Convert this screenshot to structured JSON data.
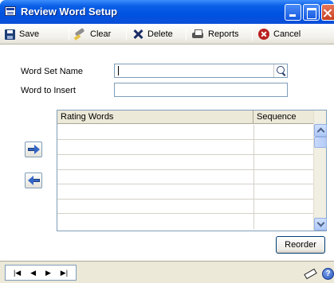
{
  "window": {
    "title": "Review Word Setup"
  },
  "toolbar": {
    "save_label": "Save",
    "clear_label": "Clear",
    "delete_label": "Delete",
    "reports_label": "Reports",
    "cancel_label": "Cancel"
  },
  "form": {
    "word_set_name_label": "Word Set Name",
    "word_set_name_value": "",
    "word_to_insert_label": "Word to Insert",
    "word_to_insert_value": ""
  },
  "grid": {
    "columns": [
      "Rating Words",
      "Sequence"
    ],
    "rows": [
      [
        "",
        ""
      ],
      [
        "",
        ""
      ],
      [
        "",
        ""
      ],
      [
        "",
        ""
      ],
      [
        "",
        ""
      ],
      [
        "",
        ""
      ],
      [
        "",
        ""
      ]
    ]
  },
  "buttons": {
    "reorder_label": "Reorder"
  },
  "status": {
    "help_glyph": "?"
  }
}
